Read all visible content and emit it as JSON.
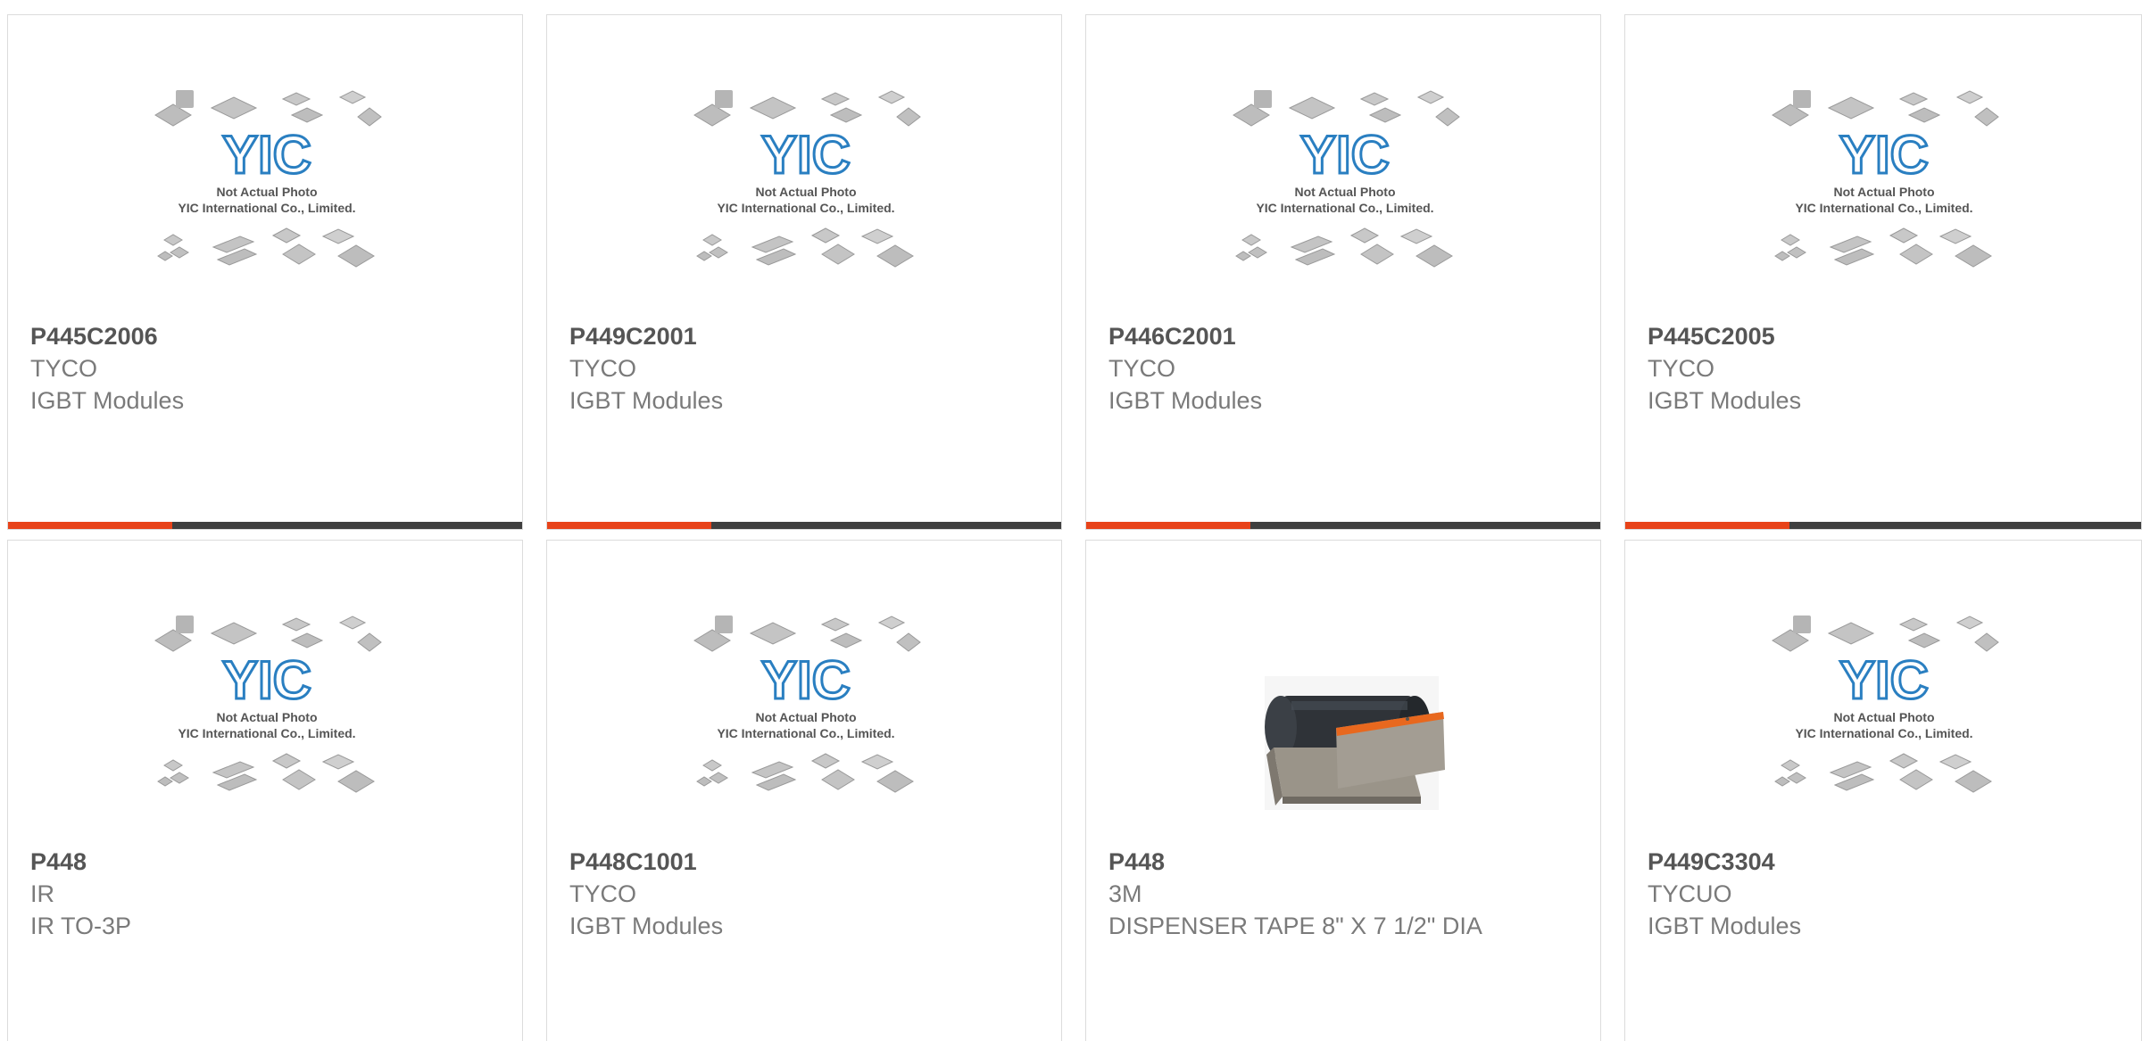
{
  "colors": {
    "accent": "#e8431a",
    "bar": "#3f3f3f",
    "border": "#dcdcdc",
    "logo_blue": "#2a7fc1"
  },
  "placeholder": {
    "logo_text": "YIC",
    "line1": "Not Actual Photo",
    "line2": "YIC International Co., Limited."
  },
  "products": [
    {
      "part_no": "P445C2006",
      "brand": "TYCO",
      "description": "IGBT Modules",
      "image": "placeholder"
    },
    {
      "part_no": "P449C2001",
      "brand": "TYCO",
      "description": "IGBT Modules",
      "image": "placeholder"
    },
    {
      "part_no": "P446C2001",
      "brand": "TYCO",
      "description": "IGBT Modules",
      "image": "placeholder"
    },
    {
      "part_no": "P445C2005",
      "brand": "TYCO",
      "description": "IGBT Modules",
      "image": "placeholder"
    },
    {
      "part_no": "P448",
      "brand": "IR",
      "description": "IR TO-3P",
      "image": "placeholder"
    },
    {
      "part_no": "P448C1001",
      "brand": "TYCO",
      "description": "IGBT Modules",
      "image": "placeholder"
    },
    {
      "part_no": "P448",
      "brand": "3M",
      "description": "DISPENSER TAPE 8\" X 7 1/2\" DIA",
      "image": "tape-dispenser"
    },
    {
      "part_no": "P449C3304",
      "brand": "TYCUO",
      "description": "IGBT Modules",
      "image": "placeholder"
    }
  ]
}
